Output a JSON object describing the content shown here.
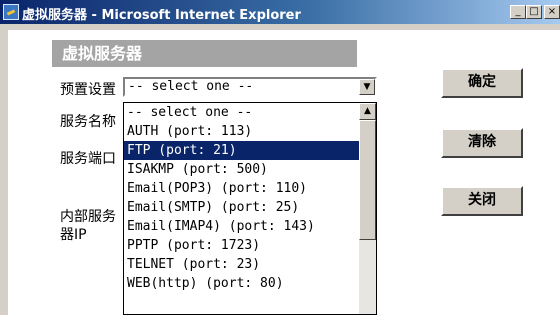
{
  "window": {
    "title": "虚拟服务器 - Microsoft Internet Explorer",
    "minimize": "_",
    "maximize": "□",
    "close": "×"
  },
  "form": {
    "header": "虚拟服务器",
    "preset_label": "预置设置",
    "service_name_label": "服务名称",
    "service_port_label": "服务端口",
    "internal_ip_label_line1": "内部服务",
    "internal_ip_label_line2": "器IP",
    "select_value": "-- select one --",
    "options": [
      "-- select one --",
      "AUTH (port: 113)",
      "FTP (port: 21)",
      "ISAKMP (port: 500)",
      "Email(POP3) (port: 110)",
      "Email(SMTP) (port: 25)",
      "Email(IMAP4) (port: 143)",
      "PPTP (port: 1723)",
      "TELNET (port: 23)",
      "WEB(http) (port: 80)"
    ],
    "highlighted_option": "FTP (port: 21)"
  },
  "buttons": {
    "ok": "确定",
    "clear": "清除",
    "close": "关闭"
  },
  "icons": {
    "arrow_down": "▼",
    "arrow_up": "▲"
  }
}
